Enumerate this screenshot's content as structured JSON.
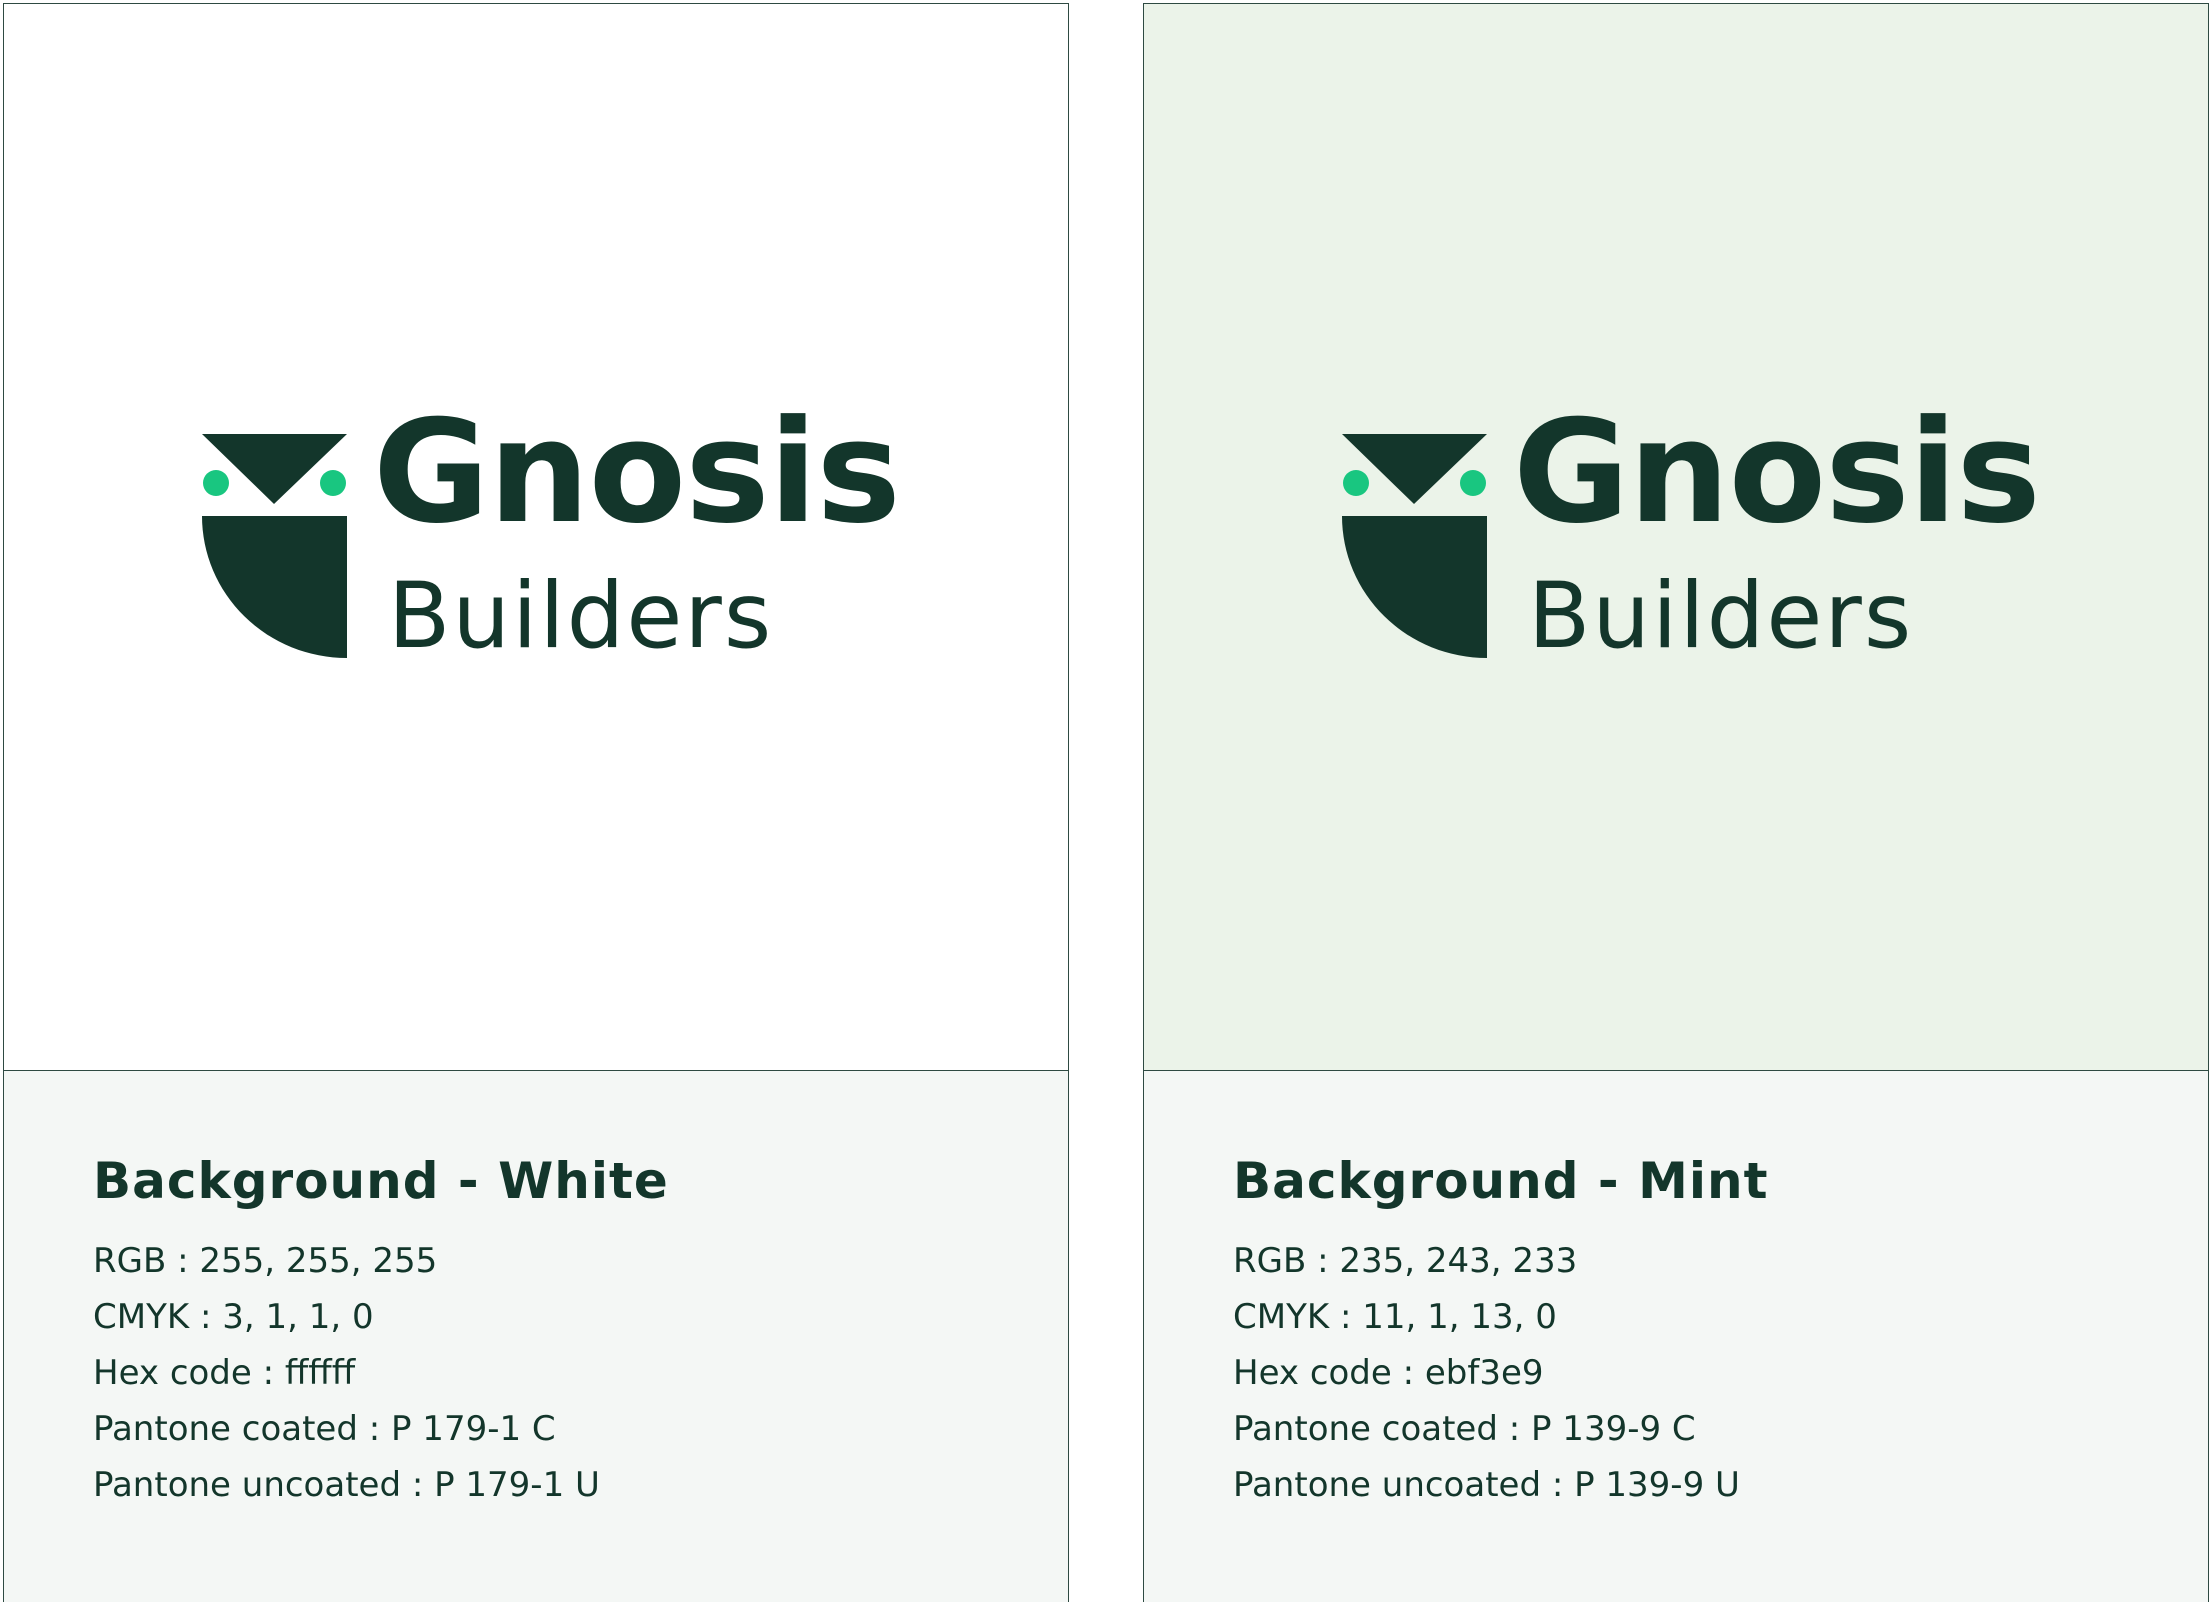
{
  "brand": {
    "wordmark_top": "Gnosis",
    "wordmark_bottom": "Builders",
    "colors": {
      "dark_green": "#13362b",
      "accent_green": "#19c680"
    }
  },
  "cards": [
    {
      "title": "Background - White",
      "background_color": "#ffffff",
      "specs": [
        "RGB : 255, 255, 255",
        "CMYK : 3, 1, 1, 0",
        "Hex code : ffffff",
        "Pantone coated : P 179-1 C",
        "Pantone uncoated : P 179-1 U"
      ]
    },
    {
      "title": "Background - Mint",
      "background_color": "#ebf3e9",
      "specs": [
        "RGB : 235, 243, 233",
        "CMYK : 11, 1, 13, 0",
        "Hex code : ebf3e9",
        "Pantone coated : P 139-9 C",
        "Pantone uncoated : P 139-9 U"
      ]
    }
  ]
}
